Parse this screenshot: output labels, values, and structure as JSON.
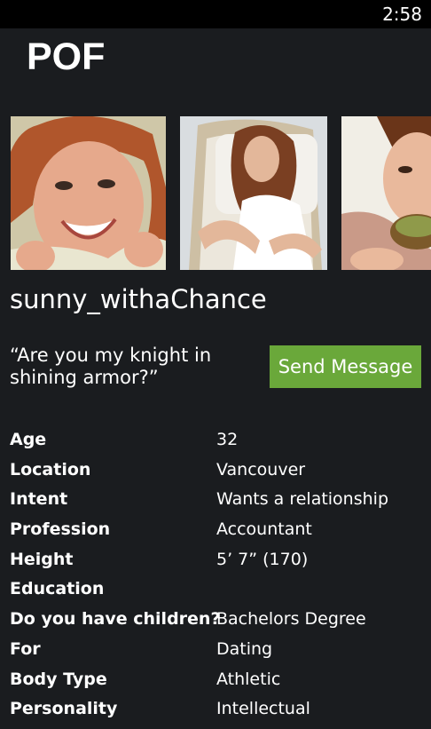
{
  "status_bar": {
    "time": "2:58"
  },
  "app": {
    "title": "POF"
  },
  "profile": {
    "username": "sunny_withaChance",
    "tagline": "“Are you my knight in shining armor?”",
    "send_message_label": "Send Message",
    "photos": [
      {
        "subject": "smiling-redhead-woman"
      },
      {
        "subject": "woman-relaxing-on-chair"
      },
      {
        "subject": "woman-holding-bowl"
      }
    ]
  },
  "details": [
    {
      "label": "Age",
      "value": "32"
    },
    {
      "label": "Location",
      "value": "Vancouver"
    },
    {
      "label": "Intent",
      "value": "Wants a relationship"
    },
    {
      "label": "Profession",
      "value": "Accountant"
    },
    {
      "label": "Height",
      "value": "5’ 7” (170)"
    },
    {
      "label": "Education",
      "value": ""
    },
    {
      "label": "Do you have children?",
      "value": "Bachelors Degree"
    },
    {
      "label": "For",
      "value": "Dating"
    },
    {
      "label": "Body Type",
      "value": "Athletic"
    },
    {
      "label": "Personality",
      "value": "Intellectual"
    }
  ],
  "colors": {
    "background": "#1a1c1f",
    "status_bar": "#000000",
    "accent_button": "#6aa83a",
    "text": "#ffffff"
  }
}
